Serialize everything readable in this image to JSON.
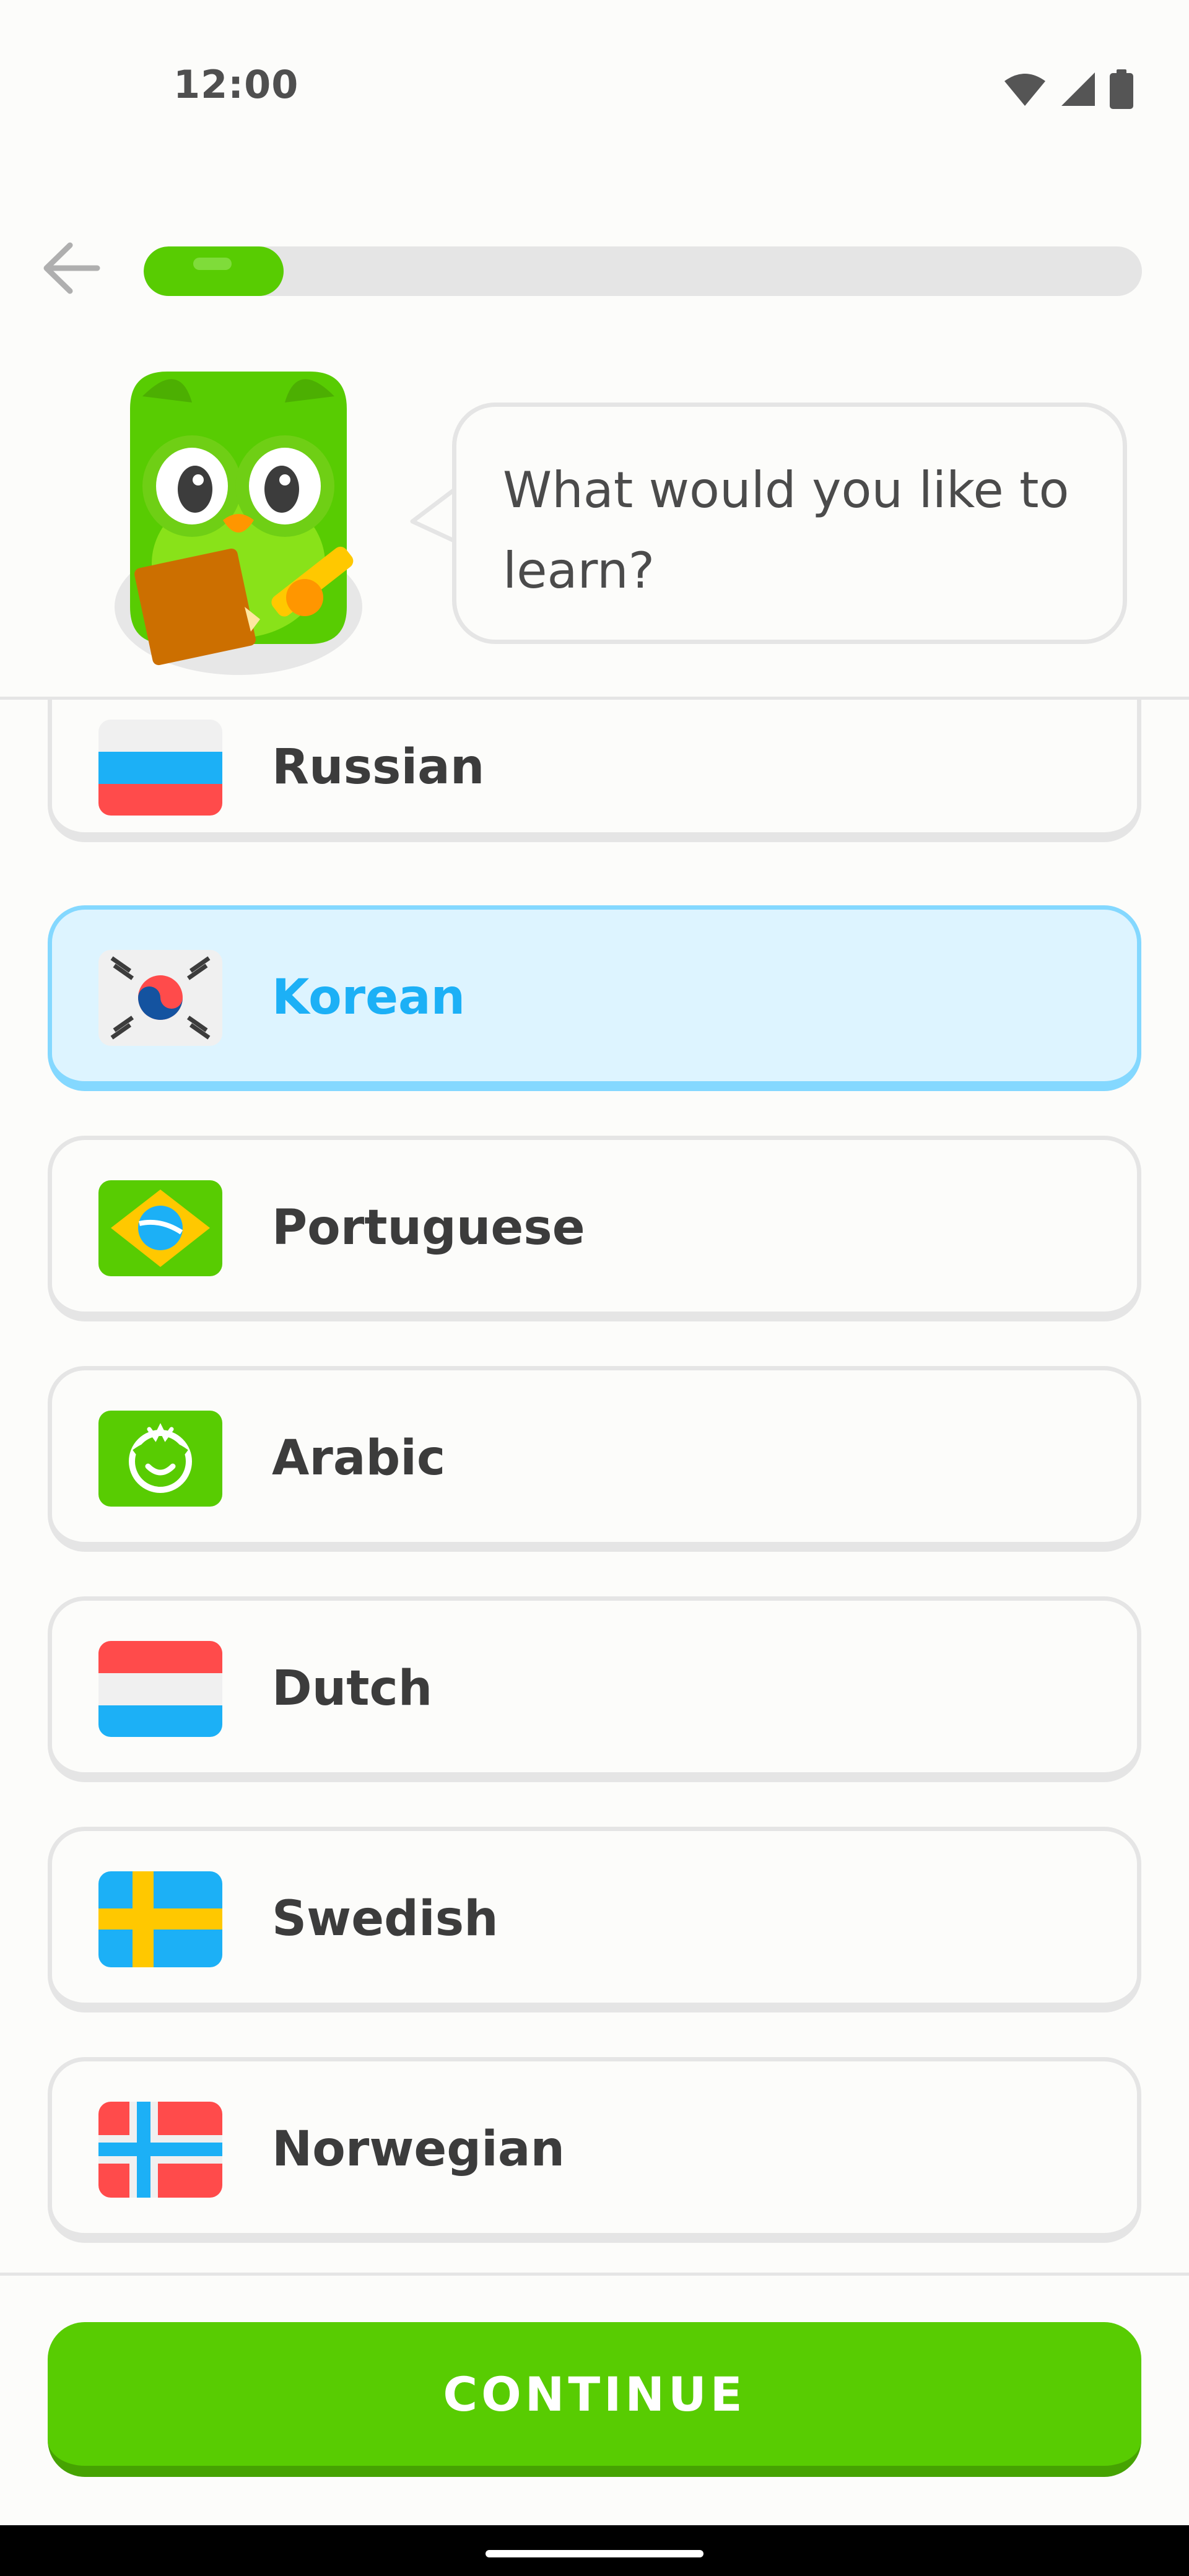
{
  "status_bar": {
    "time": "12:00",
    "icons": [
      "wifi-icon",
      "signal-icon",
      "battery-icon"
    ]
  },
  "header": {
    "back_icon": "arrow-left-icon",
    "progress": 0.14
  },
  "prompt": {
    "mascot": "owl-mascot",
    "line1": "What would you like to",
    "line2": "learn?"
  },
  "languages": [
    {
      "name": "Russian",
      "flag": "russia-flag-icon",
      "selected": false
    },
    {
      "name": "Korean",
      "flag": "korea-flag-icon",
      "selected": true
    },
    {
      "name": "Portuguese",
      "flag": "brazil-flag-icon",
      "selected": false
    },
    {
      "name": "Arabic",
      "flag": "arabic-flag-icon",
      "selected": false
    },
    {
      "name": "Dutch",
      "flag": "netherlands-flag-icon",
      "selected": false
    },
    {
      "name": "Swedish",
      "flag": "sweden-flag-icon",
      "selected": false
    },
    {
      "name": "Norwegian",
      "flag": "norway-flag-icon",
      "selected": false
    }
  ],
  "footer": {
    "continue_label": "CONTINUE"
  },
  "colors": {
    "accent_green": "#58cc02",
    "selected_blue": "#1cb0f6",
    "selected_bg": "#ddf4ff",
    "border": "#e5e5e5"
  }
}
